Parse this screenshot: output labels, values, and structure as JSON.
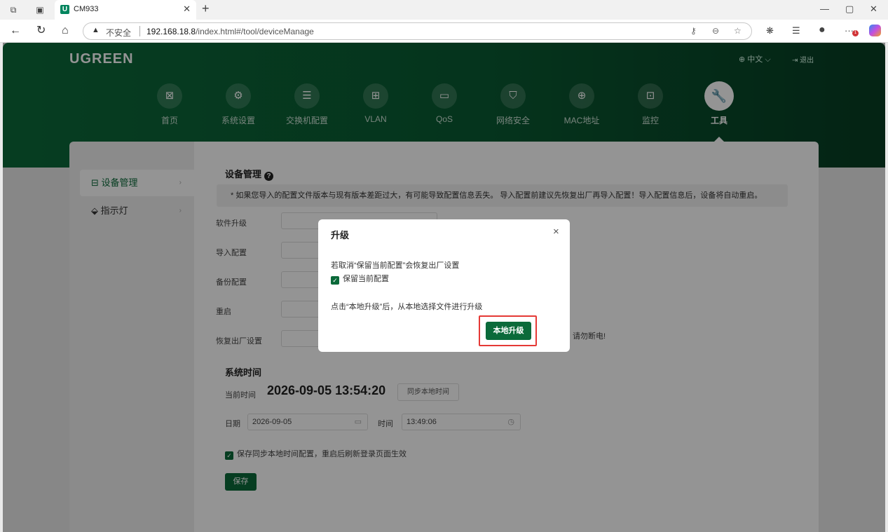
{
  "browser": {
    "tab_title": "CM933",
    "tab_favicon": "U",
    "new_tab": "+",
    "security_text": "不安全",
    "url_host": "192.168.18.8",
    "url_path": "/index.html#/tool/deviceManage",
    "notification_count": "1"
  },
  "header": {
    "logo": "UGREEN",
    "language": "中文",
    "logout": "退出"
  },
  "nav": [
    {
      "label": "首页",
      "icon": "home-icon",
      "glyph": "⊠"
    },
    {
      "label": "系统设置",
      "icon": "gear-icon",
      "glyph": "⚙"
    },
    {
      "label": "交换机配置",
      "icon": "switch-icon",
      "glyph": "☰"
    },
    {
      "label": "VLAN",
      "icon": "vlan-icon",
      "glyph": "⊞"
    },
    {
      "label": "QoS",
      "icon": "qos-icon",
      "glyph": "▭"
    },
    {
      "label": "网络安全",
      "icon": "shield-icon",
      "glyph": "⛉"
    },
    {
      "label": "MAC地址",
      "icon": "globe-icon",
      "glyph": "⊕"
    },
    {
      "label": "监控",
      "icon": "monitor-icon",
      "glyph": "⊡"
    },
    {
      "label": "工具",
      "icon": "wrench-icon",
      "glyph": "🔧"
    }
  ],
  "sidebar": {
    "items": [
      {
        "label": "设备管理"
      },
      {
        "label": "指示灯"
      }
    ]
  },
  "device": {
    "title": "设备管理",
    "notice": "* 如果您导入的配置文件版本与现有版本差距过大，有可能导致配置信息丢失。 导入配置前建议先恢复出厂再导入配置！导入配置信息后，设备将自动重启。",
    "rows": [
      "软件升级",
      "导入配置",
      "备份配置",
      "重启",
      "恢复出厂设置"
    ],
    "warning_tail": "请勿断电!"
  },
  "time": {
    "title": "系统时间",
    "current_label": "当前时间",
    "current_value": "2026-09-05 13:54:20",
    "sync_button": "同步本地时间",
    "date_label": "日期",
    "date_value": "2026-09-05",
    "time_label": "时间",
    "time_value": "13:49:06",
    "keep_label": "保存同步本地时间配置，重启后刷新登录页面生效",
    "save_button": "保存"
  },
  "dialog": {
    "title": "升级",
    "close": "×",
    "text1": "若取消“保留当前配置”会恢复出厂设置",
    "checkbox_label": "保留当前配置",
    "text2": "点击“本地升级”后，从本地选择文件进行升级",
    "upgrade_button": "本地升级"
  },
  "colors": {
    "brand": "#0b6a3a",
    "highlight": "#e53935"
  }
}
